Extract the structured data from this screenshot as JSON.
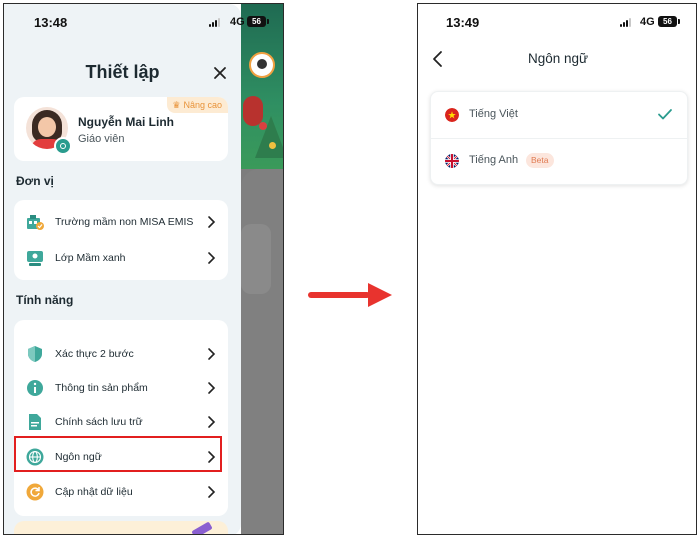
{
  "screen1": {
    "status": {
      "time": "13:48",
      "network": "4G",
      "battery": "56"
    },
    "title": "Thiết lập",
    "profile": {
      "name": "Nguyễn Mai Linh",
      "role": "Giáo viên",
      "upgrade_label": "Nâng cao"
    },
    "section_unit": "Đơn vị",
    "unit_items": [
      {
        "label": "Trường mầm non MISA EMIS",
        "icon": "school-icon"
      },
      {
        "label": "Lớp Mầm xanh",
        "icon": "classroom-icon"
      }
    ],
    "section_features": "Tính năng",
    "feature_items": [
      {
        "label": "Xác thực 2 bước",
        "icon": "shield-icon"
      },
      {
        "label": "Thông tin sản phẩm",
        "icon": "info-icon"
      },
      {
        "label": "Chính sách lưu trữ",
        "icon": "document-icon"
      },
      {
        "label": "Ngôn ngữ",
        "icon": "globe-icon"
      },
      {
        "label": "Cập nhật dữ liệu",
        "icon": "refresh-icon"
      }
    ],
    "highlighted_item": "Ngôn ngữ"
  },
  "screen2": {
    "status": {
      "time": "13:49",
      "network": "4G",
      "battery": "56"
    },
    "title": "Ngôn ngữ",
    "languages": [
      {
        "label": "Tiếng Việt",
        "flag": "vietnam-flag-icon",
        "selected": true
      },
      {
        "label": "Tiếng Anh",
        "flag": "uk-flag-icon",
        "badge": "Beta",
        "selected": false
      }
    ]
  },
  "colors": {
    "accent": "#2a9c8e",
    "highlight": "#e21f1f",
    "arrow": "#e8332e",
    "beta": "#e07b52",
    "upgrade": "#e8933a"
  }
}
